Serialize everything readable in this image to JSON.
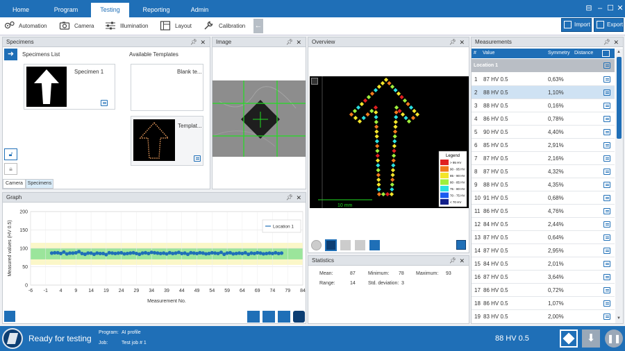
{
  "nav": {
    "tabs": [
      "Home",
      "Program",
      "Testing",
      "Reporting",
      "Admin"
    ],
    "active": "Testing"
  },
  "toolbar": {
    "automation": "Automation",
    "camera": "Camera",
    "illumination": "Illumination",
    "layout": "Layout",
    "calibration": "Calibration",
    "import": "Import",
    "export": "Export"
  },
  "specimens": {
    "title": "Specimens",
    "list_label": "Specimens List",
    "templates_label": "Available Templates",
    "specimen1": "Specimen 1",
    "blank_template": "Blank te...",
    "template": "Templat...",
    "tab_camera": "Camera",
    "tab_specimens": "Specimens"
  },
  "image": {
    "title": "Image"
  },
  "overview": {
    "title": "Overview",
    "scale_label": "10 mm",
    "legend_title": "Legend",
    "legend": [
      {
        "label": "> 95 HV",
        "color": "#e02020"
      },
      {
        "label": "90 - 95 HV",
        "color": "#f07a1c"
      },
      {
        "label": "85 - 90 HV",
        "color": "#f3e52a"
      },
      {
        "label": "80 - 85 HV",
        "color": "#9fef3c"
      },
      {
        "label": "75 - 80 HV",
        "color": "#2be0e0"
      },
      {
        "label": "70 - 75 HV",
        "color": "#1b5cf0"
      },
      {
        "label": "< 70 HV",
        "color": "#13208a"
      }
    ]
  },
  "statistics": {
    "title": "Statistics",
    "mean_label": "Mean:",
    "mean": "87",
    "min_label": "Minimum:",
    "min": "78",
    "max_label": "Maximum:",
    "max": "93",
    "range_label": "Range:",
    "range": "14",
    "std_label": "Std. deviation:",
    "std": "3"
  },
  "graph": {
    "title": "Graph",
    "legend": "Location 1"
  },
  "measurements": {
    "title": "Measurements",
    "col_no": "#",
    "col_value": "Value",
    "col_symmetry": "Symmetry",
    "col_distance": "Distance",
    "group": "Location 1",
    "rows": [
      {
        "no": "1",
        "value": "87 HV 0.5",
        "sym": "0,63%"
      },
      {
        "no": "2",
        "value": "88 HV 0.5",
        "sym": "1,10%"
      },
      {
        "no": "3",
        "value": "88 HV 0.5",
        "sym": "0,16%"
      },
      {
        "no": "4",
        "value": "86 HV 0.5",
        "sym": "0,78%"
      },
      {
        "no": "5",
        "value": "90 HV 0.5",
        "sym": "4,40%"
      },
      {
        "no": "6",
        "value": "85 HV 0.5",
        "sym": "2,91%"
      },
      {
        "no": "7",
        "value": "87 HV 0.5",
        "sym": "2,16%"
      },
      {
        "no": "8",
        "value": "87 HV 0.5",
        "sym": "4,32%"
      },
      {
        "no": "9",
        "value": "88 HV 0.5",
        "sym": "4,35%"
      },
      {
        "no": "10",
        "value": "91 HV 0.5",
        "sym": "0,68%"
      },
      {
        "no": "11",
        "value": "86 HV 0.5",
        "sym": "4,76%"
      },
      {
        "no": "12",
        "value": "84 HV 0.5",
        "sym": "2,44%"
      },
      {
        "no": "13",
        "value": "87 HV 0.5",
        "sym": "0,64%"
      },
      {
        "no": "14",
        "value": "87 HV 0.5",
        "sym": "2,95%"
      },
      {
        "no": "15",
        "value": "84 HV 0.5",
        "sym": "2,01%"
      },
      {
        "no": "16",
        "value": "87 HV 0.5",
        "sym": "3,64%"
      },
      {
        "no": "17",
        "value": "86 HV 0.5",
        "sym": "0,72%"
      },
      {
        "no": "18",
        "value": "86 HV 0.5",
        "sym": "1,07%"
      },
      {
        "no": "19",
        "value": "83 HV 0.5",
        "sym": "2,00%"
      }
    ]
  },
  "status": {
    "ready": "Ready for testing",
    "program_label": "Program:",
    "program": "AI profile",
    "job_label": "Job:",
    "job": "Test job # 1",
    "current": "88 HV 0.5"
  },
  "chart_data": {
    "type": "scatter",
    "xlabel": "Measurement No.",
    "ylabel": "Measured values (HV 0.5)",
    "xlim": [
      -6,
      84
    ],
    "ylim": [
      0,
      200
    ],
    "xticks": [
      "-6",
      "-1",
      "4",
      "9",
      "14",
      "19",
      "24",
      "29",
      "34",
      "39",
      "44",
      "49",
      "54",
      "59",
      "64",
      "69",
      "74",
      "79",
      "84"
    ],
    "yticks": [
      "0",
      "50",
      "100",
      "150",
      "200"
    ],
    "series": [
      {
        "name": "Location 1",
        "x": [
          1,
          2,
          3,
          4,
          5,
          6,
          7,
          8,
          9,
          10,
          11,
          12,
          13,
          14,
          15,
          16,
          17,
          18,
          19,
          20,
          21,
          22,
          23,
          24,
          25,
          26,
          27,
          28,
          29,
          30,
          31,
          32,
          33,
          34,
          35,
          36,
          37,
          38,
          39,
          40,
          41,
          42,
          43,
          44,
          45,
          46,
          47,
          48,
          49,
          50,
          51,
          52,
          53,
          54,
          55,
          56,
          57,
          58,
          59,
          60,
          61,
          62,
          63,
          64,
          65,
          66,
          67,
          68,
          69,
          70,
          71,
          72,
          73,
          74,
          75,
          76,
          77
        ],
        "values": [
          87,
          88,
          88,
          86,
          90,
          85,
          87,
          87,
          88,
          91,
          86,
          84,
          87,
          87,
          84,
          87,
          86,
          86,
          83,
          88,
          87,
          86,
          87,
          88,
          85,
          86,
          87,
          88,
          86,
          84,
          87,
          88,
          86,
          89,
          88,
          87,
          86,
          87,
          85,
          88,
          86,
          87,
          89,
          86,
          87,
          84,
          88,
          87,
          86,
          88,
          87,
          85,
          86,
          88,
          87,
          86,
          89,
          84,
          87,
          88,
          85,
          86,
          87,
          86,
          88,
          84,
          87,
          86,
          88,
          87,
          85,
          86,
          87,
          86,
          88,
          86,
          87
        ]
      }
    ],
    "bands": [
      {
        "from": 70,
        "to": 100,
        "color": "#9be59b"
      },
      {
        "from": 55,
        "to": 115,
        "color": "#fbf7c8"
      }
    ]
  }
}
